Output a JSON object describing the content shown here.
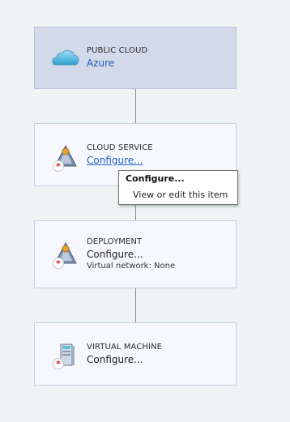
{
  "cards": {
    "public_cloud": {
      "type": "PUBLIC CLOUD",
      "value": "Azure",
      "icon": "cloud-icon"
    },
    "cloud_service": {
      "type": "CLOUD SERVICE",
      "value": "Configure...",
      "icon": "cloud-service-icon"
    },
    "deployment": {
      "type": "DEPLOYMENT",
      "value": "Configure...",
      "detail": "Virtual network: None",
      "icon": "deployment-icon"
    },
    "virtual_machine": {
      "type": "VIRTUAL MACHINE",
      "value": "Configure...",
      "icon": "virtual-machine-icon"
    }
  },
  "tooltip": {
    "title": "Configure...",
    "description": "View or edit this item"
  },
  "colors": {
    "background": "#eef4f3",
    "selected_card": "#d2d9e9",
    "card": "#f6f8fd",
    "link": "#1a5fb4",
    "cloud_blue": "#3fa9d6",
    "error_red": "#d0202a"
  }
}
